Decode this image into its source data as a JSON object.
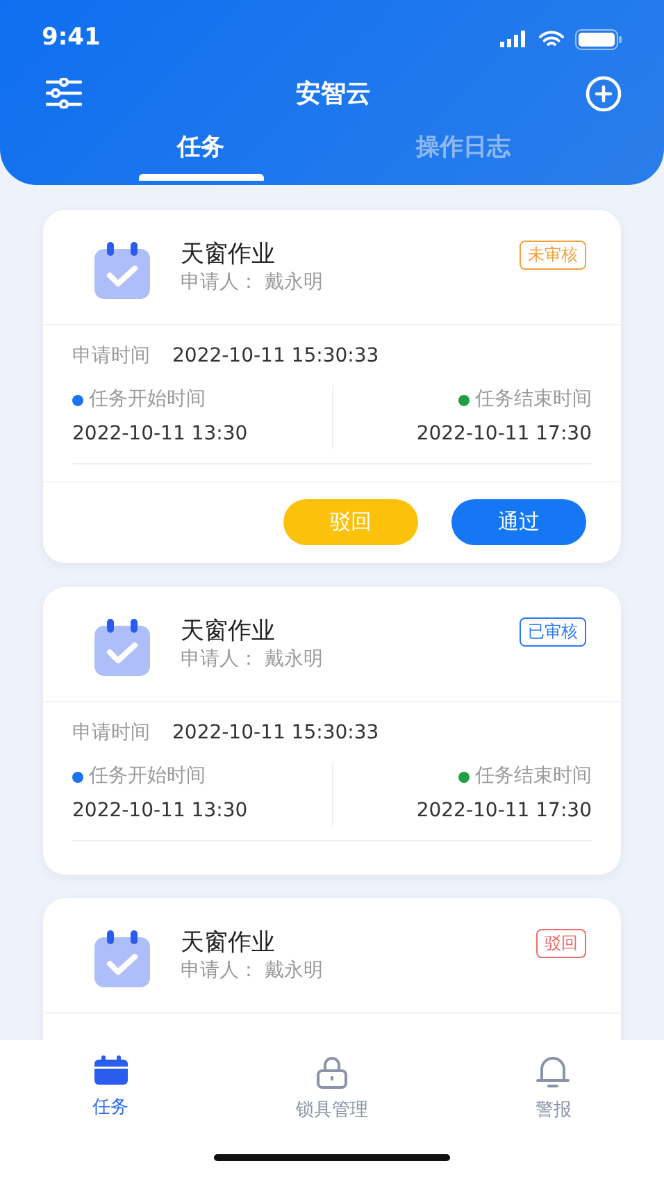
{
  "status_bar": {
    "time": "9:41"
  },
  "header": {
    "title": "安智云"
  },
  "tabs": [
    {
      "label": "任务",
      "selected": true
    },
    {
      "label": "操作日志",
      "selected": false
    }
  ],
  "tasks": [
    {
      "title": "天窗作业",
      "applicant": "申请人： 戴永明",
      "status": {
        "label": "未审核",
        "kind": "pending"
      },
      "details": {
        "apply_label": "申请时间",
        "apply_time": "2022-10-11 15:30:33",
        "start_label": "任务开始时间",
        "start_time": "2022-10-11 13:30",
        "end_label": "任务结束时间",
        "end_time": "2022-10-11 17:30"
      },
      "actions": [
        {
          "label": "驳回",
          "kind": "reject"
        },
        {
          "label": "通过",
          "kind": "approve"
        }
      ]
    },
    {
      "title": "天窗作业",
      "applicant": "申请人： 戴永明",
      "status": {
        "label": "已审核",
        "kind": "approved"
      },
      "details": {
        "apply_label": "申请时间",
        "apply_time": "2022-10-11 15:30:33",
        "start_label": "任务开始时间",
        "start_time": "2022-10-11 13:30",
        "end_label": "任务结束时间",
        "end_time": "2022-10-11 17:30"
      }
    },
    {
      "title": "天窗作业",
      "applicant": "申请人： 戴永明",
      "status": {
        "label": "驳回",
        "kind": "rejected"
      }
    }
  ],
  "bottom_nav": [
    {
      "label": "任务",
      "kind": "calendar",
      "selected": true
    },
    {
      "label": "锁具管理",
      "kind": "lock",
      "selected": false
    },
    {
      "label": "警报",
      "kind": "bell",
      "selected": false
    }
  ]
}
